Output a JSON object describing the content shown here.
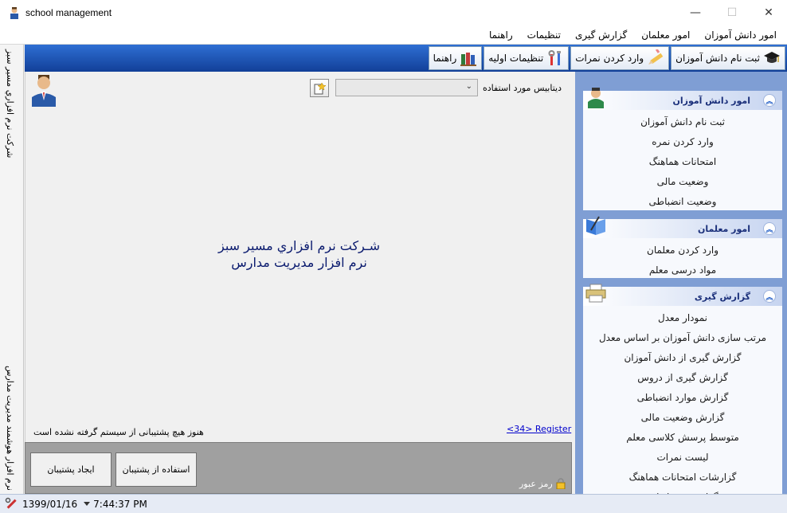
{
  "window": {
    "title": "school management",
    "minimize_glyph": "—",
    "maximize_glyph": "☐",
    "close_glyph": "✕"
  },
  "menu": [
    "امور دانش آموزان",
    "امور معلمان",
    "گزارش گیری",
    "تنظیمات",
    "راهنما"
  ],
  "left_strip": {
    "top_text": "شرکت نرم افزاري مسير سبز",
    "bottom_text": "نرم افزار هوشمند مدیریت مدارس"
  },
  "toolbar": {
    "register": "ثبت نام دانش آموزان",
    "grades": "وارد کردن نمرات",
    "settings": "تنظیمات اولیه",
    "help": "راهنما"
  },
  "main": {
    "db_label": "دیتابیس مورد استفاده",
    "db_value": "",
    "db_dropdown_glyph": "⌄",
    "line1": "شـركت نرم افزاري مسير سبز",
    "line2": "نرم افزار مديريت مدارس",
    "backup_message": "هنوز هیچ پشتیبانی از سیستم گرفته نشده است",
    "register_link": "<34> Register"
  },
  "backup": {
    "create": "ایجاد پشتیبان",
    "use": "استفاده از پشتیبان",
    "password": "رمز عبور"
  },
  "status": {
    "date": "1399/01/16",
    "time": "7:44:37 PM"
  },
  "sidebar": {
    "groups": [
      {
        "title": "امور دانش آموزان",
        "items": [
          "ثبت نام دانش آموزان",
          "وارد کردن نمره",
          "امتحانات هماهنگ",
          "وضعیت مالی",
          "وضعیت انضباطی"
        ]
      },
      {
        "title": "امور معلمان",
        "items": [
          "وارد کردن معلمان",
          "مواد درسی معلم"
        ]
      },
      {
        "title": "گزارش گیری",
        "items": [
          "نمودار معدل",
          "مرتب سازی دانش آموزان بر اساس معدل",
          "گزارش گیری از دانش آموزان",
          "گزارش گیری از دروس",
          "گزارش موارد انضباطی",
          "گزارش وضعیت مالی",
          "متوسط پرسش کلاسی معلم",
          "لیست نمرات",
          "گزارشات امتحانات هماهنگ",
          "گزارش به خانواده"
        ]
      }
    ]
  },
  "colors": {
    "toolbar": "#1f56b8",
    "sidebar": "#7f9ed4",
    "center_text": "#0a1a6e",
    "link": "#0000cc"
  }
}
